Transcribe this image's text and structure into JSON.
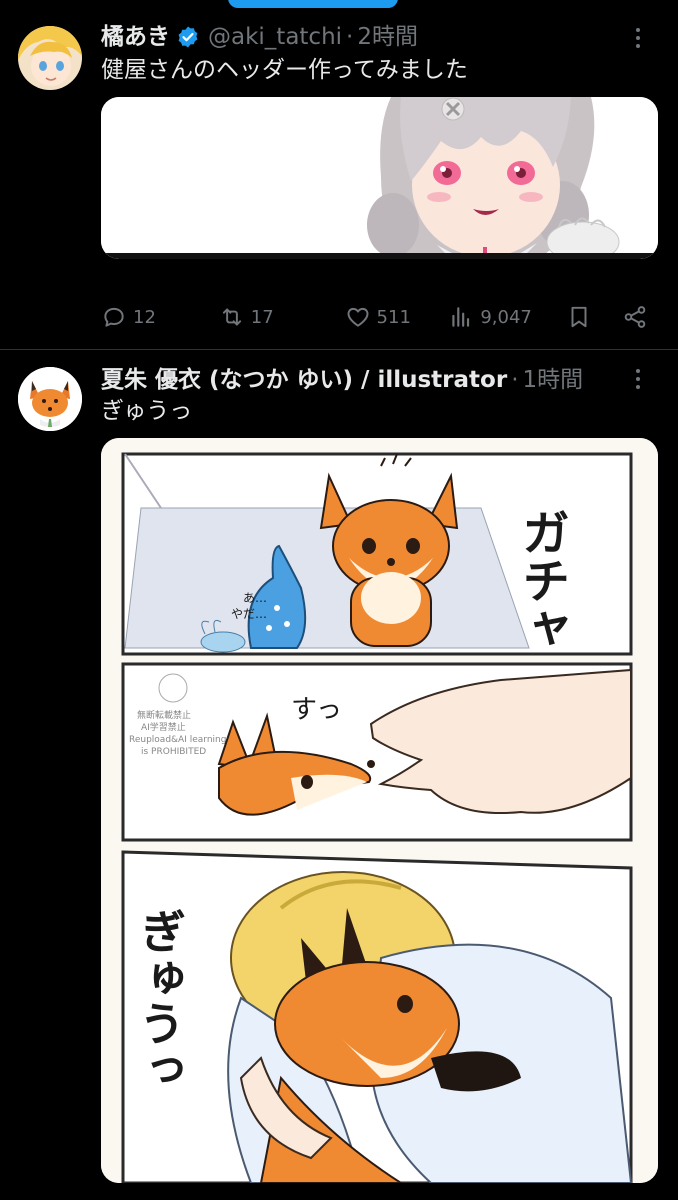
{
  "colors": {
    "background": "#000000",
    "text": "#e7e9ea",
    "muted": "#71767b",
    "accent": "#1d9bf0",
    "divider": "#2f3336"
  },
  "tweets": [
    {
      "author": {
        "name": "橘あき",
        "verified": true,
        "handle": "@aki_tatchi",
        "separator": "·",
        "time": "2時間",
        "avatar_icon": "avatar-girl-blonde"
      },
      "text": "健屋さんのヘッダー作ってみました",
      "media_description_icon": "illustration-girl-header",
      "stats": {
        "replies": "12",
        "retweets": "17",
        "likes": "511",
        "views": "9,047"
      }
    },
    {
      "author": {
        "name": "夏朱 優衣 (なつか ゆい) / illustrator",
        "separator": "·",
        "time": "1時間",
        "avatar_icon": "avatar-fox"
      },
      "text": "ぎゅうっ",
      "media_description_icon": "manga-fox-hug",
      "manga": {
        "sfx_panel1": "ガチャ",
        "sfx_panel2": "すっ",
        "sfx_panel3": "ぎゅうっ",
        "whisper": "あ…\nやだ…",
        "stamp_lines": [
          "無断転載禁止",
          "AI学習禁止",
          "Reupload&AI learning",
          "is PROHIBITED"
        ]
      }
    }
  ]
}
